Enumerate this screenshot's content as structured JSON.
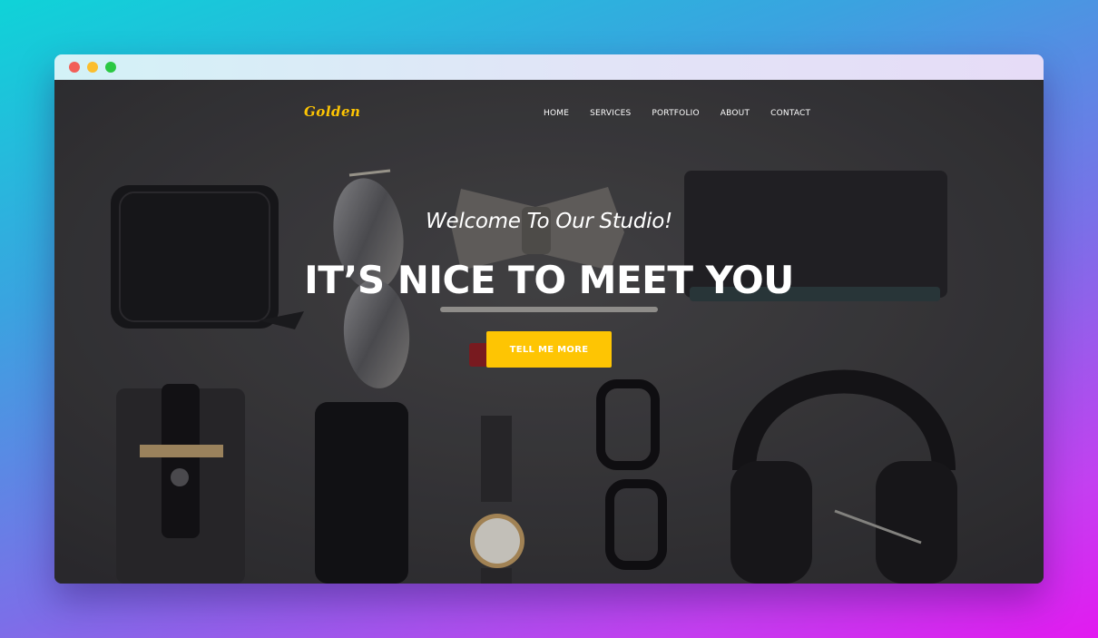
{
  "window": {
    "controls": [
      "close",
      "minimize",
      "maximize"
    ]
  },
  "brand": {
    "logo_text": "Golden",
    "accent_color": "#fec503"
  },
  "nav": {
    "items": [
      {
        "label": "HOME"
      },
      {
        "label": "SERVICES"
      },
      {
        "label": "PORTFOLIO"
      },
      {
        "label": "ABOUT"
      },
      {
        "label": "CONTACT"
      }
    ]
  },
  "hero": {
    "subtitle": "Welcome To Our Studio!",
    "headline": "IT’S NICE TO MEET YOU",
    "cta_label": "TELL ME MORE",
    "background_image": "flat-lay of wallet, sunglasses, bow tie, notebook, pen, phone, phone sleeve, wristwatch, eyeglasses and headphones on dark surface"
  }
}
